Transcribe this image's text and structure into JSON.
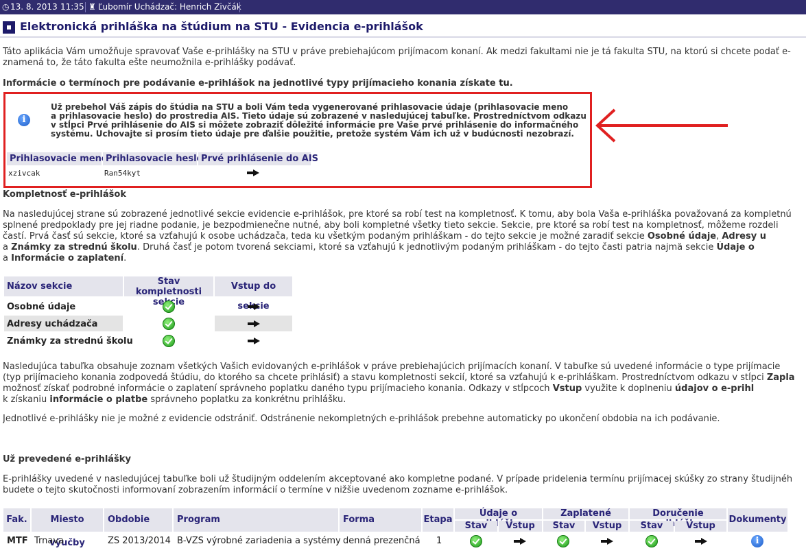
{
  "topbar": {
    "date": "13. 8. 2013",
    "time": "11:35",
    "user": "Ľubomír Uchádzač: Henrich Zivčák"
  },
  "title": "Elektronická prihláška na štúdium na STU - Evidencia e-prihlášok",
  "intro": {
    "line1": "Táto aplikácia Vám umožňuje spravovať Vaše e-prihlášky na STU v práve prebiehajúcom prijímacom konaní. Ak medzi fakultami nie je tá fakulta STU, na ktorú si chcete podať e-",
    "line2": "znamená to, že táto fakulta ešte neumožnila e-prihlášky podávať."
  },
  "terms_info": {
    "text": "Informácie o termínoch pre podávanie e-prihlášok na jednotlivé typy prijímacieho konania získate",
    "link": "tu",
    "end": "."
  },
  "notice": {
    "lines": [
      "Už prebehol Váš zápis do štúdia na STU a boli Vám teda vygenerované prihlasovacie údaje (prihlasovacie meno",
      "a prihlasovacie heslo) do prostredia AIS. Tieto údaje sú zobrazené v nasledujúcej tabuľke. Prostredníctvom odkazu",
      "v stĺpci Prvé prihlásenie do AIS si môžete zobraziť dôležité informácie pre Vaše prvé prihlásenie do informačného",
      "systému. Uchovajte si prosím tieto údaje pre ďalšie použitie, pretože systém Vám ich už v budúcnosti nezobrazí."
    ],
    "table": {
      "headers": [
        "Prihlasovacie meno",
        "Prihlasovacie heslo",
        "Prvé prihlásenie do AIS"
      ],
      "login": "xzivcak",
      "password": "Ran54kyt"
    }
  },
  "completeness": {
    "heading": "Kompletnosť e-prihlášok",
    "lines": [
      "Na nasledujúcej strane sú zobrazené jednotlivé sekcie evidencie e-prihlášok, pre ktoré sa robí test na kompletnosť. K tomu, aby bola Vaša e-prihláška považovaná za kompletnú",
      "splnené predpoklady pre jej riadne podanie, je bezpodmienečne nutné, aby boli kompletné všetky tieto sekcie. Sekcie, pre ktoré sa robí test na kompletnosť, môžeme rozdeli",
      "častí. Prvá časť sú sekcie, ktoré sa vzťahujú k osobe uchádzača, teda ku všetkým podaným prihláškam - do tejto sekcie je možné zaradiť sekcie",
      "a",
      "Druhá časť je potom tvorená sekciami, ktoré sa vzťahujú k jednotlivým podaným prihláškam - do tejto časti patria najmä sekcie",
      "a"
    ],
    "bold1": "Osobné údaje",
    "bold2": "Adresy u",
    "bold3": "Známky za strednú školu",
    "bold4": "Údaje o",
    "bold5": "Informácie o zaplatení",
    "end": "."
  },
  "sections_table": {
    "headers": [
      "Názov sekcie",
      "Stav kompletnosti sekcie",
      "Vstup do sekcie"
    ],
    "rows": [
      {
        "name": "Osobné údaje"
      },
      {
        "name": "Adresy uchádzača"
      },
      {
        "name": "Známky za strednú školu"
      }
    ]
  },
  "applications_info": {
    "lines": [
      "Nasledujúca tabuľka obsahuje zoznam všetkých Vašich evidovaných e-prihlášok v práve prebiehajúcich prijímacích konaní. V tabuľke sú uvedené informácie o type prijímacie",
      "(typ prijímacieho konania zodpovedá štúdiu, do ktorého sa chcete prihlásiť) a stavu kompletnosti sekcií, ktoré sa vzťahujú k e-prihláškam. Prostredníctvom odkazu v stĺpci",
      "možnosť získať podrobné informácie o zaplatení správneho poplatku daného typu prijímacieho konania. Odkazy v stĺpcoch",
      "využite k doplneniu",
      "k získaniu",
      "správneho poplatku za konkrétnu prihlášku."
    ],
    "bold_zapla": "Zapla",
    "bold_vstup": "Vstup",
    "bold_udajov": "údajov o e-prihl",
    "bold_info_platbe": "informácie o platbe"
  },
  "removal_note": "Jednotlivé e-prihlášky nie je možné z evidencie odstrániť. Odstránenie nekompletných e-prihlášok prebehne automaticky po ukončení obdobia na ich podávanie.",
  "transferred": {
    "heading": "Už prevedené e-prihlášky",
    "line1": "E-prihlášky uvedené v nasledujúcej tabuľke boli už študijným oddelením akceptované ako kompletne podané. V prípade pridelenia termínu prijímacej skúšky zo strany študijnéh",
    "line2": "budete o tejto skutočnosti informovaní zobrazením informácií o termíne v nižšie uvedenom zozname e-prihlášok."
  },
  "apps_table": {
    "headers": {
      "fak": "Fak.",
      "miesto": "Miesto výučby",
      "obdobie": "Obdobie",
      "program": "Program",
      "forma": "Forma",
      "etapa": "Etapa",
      "udaje": "Údaje o prihláške",
      "zaplatene": "Zaplatené",
      "dorucenie": "Doručenie prihlášky",
      "dokumenty": "Dokumenty",
      "stav": "Stav",
      "vstup": "Vstup"
    },
    "row": {
      "fak": "MTF",
      "miesto": "Trnava",
      "obdobie": "ZS 2013/2014",
      "program": "B-VZS výrobné zariadenia a systémy",
      "forma": "denná prezenčná",
      "etapa": "1"
    }
  },
  "icons": {
    "info": "info-icon",
    "check": "check-icon",
    "arrow": "arrow-right-icon"
  }
}
